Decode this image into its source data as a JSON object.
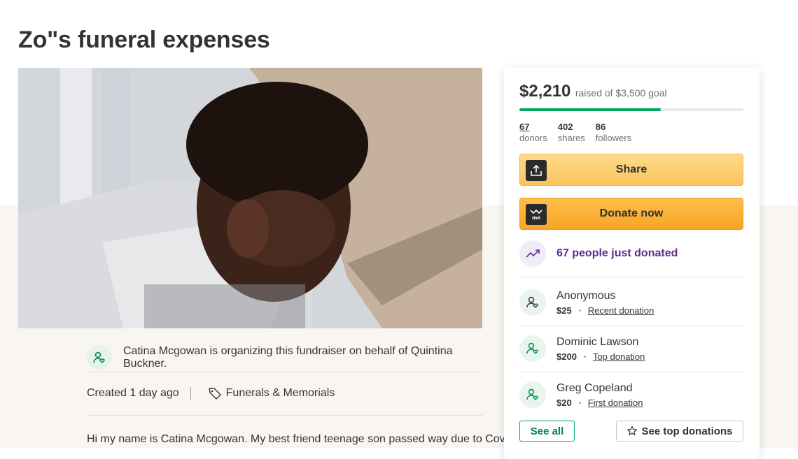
{
  "campaign": {
    "title": "Zo\"s funeral expenses",
    "organizer_text": "Catina Mcgowan is organizing this fundraiser on behalf of Quintina Buckner.",
    "created": "Created 1 day ago",
    "category": "Funerals & Memorials",
    "story_first_line": "Hi my name is Catina Mcgowan. My best friend teenage son passed way due to Covid."
  },
  "donation_panel": {
    "raised_amount": "$2,210",
    "raised_goal_text": "raised of $3,500 goal",
    "progress_fraction": 0.63,
    "stats": [
      {
        "number": "67",
        "label": "donors"
      },
      {
        "number": "402",
        "label": "shares"
      },
      {
        "number": "86",
        "label": "followers"
      }
    ],
    "share_label": "Share",
    "donate_label": "Donate now",
    "recent_activity": "67 people just donated",
    "donations": [
      {
        "name": "Anonymous",
        "amount": "$25",
        "tag": "Recent donation"
      },
      {
        "name": "Dominic Lawson",
        "amount": "$200",
        "tag": "Top donation"
      },
      {
        "name": "Greg Copeland",
        "amount": "$20",
        "tag": "First donation"
      }
    ],
    "see_all_label": "See all",
    "see_top_label": "See top donations"
  },
  "colors": {
    "accent_green": "#02a95c",
    "share_button": "#fbc25c",
    "donate_button": "#f7a523",
    "activity_purple": "#5b2d8e"
  },
  "icons": [
    "share-icon",
    "gofundme-logo-icon",
    "trending-up-icon",
    "donor-heart-icon",
    "tag-icon",
    "star-icon"
  ]
}
